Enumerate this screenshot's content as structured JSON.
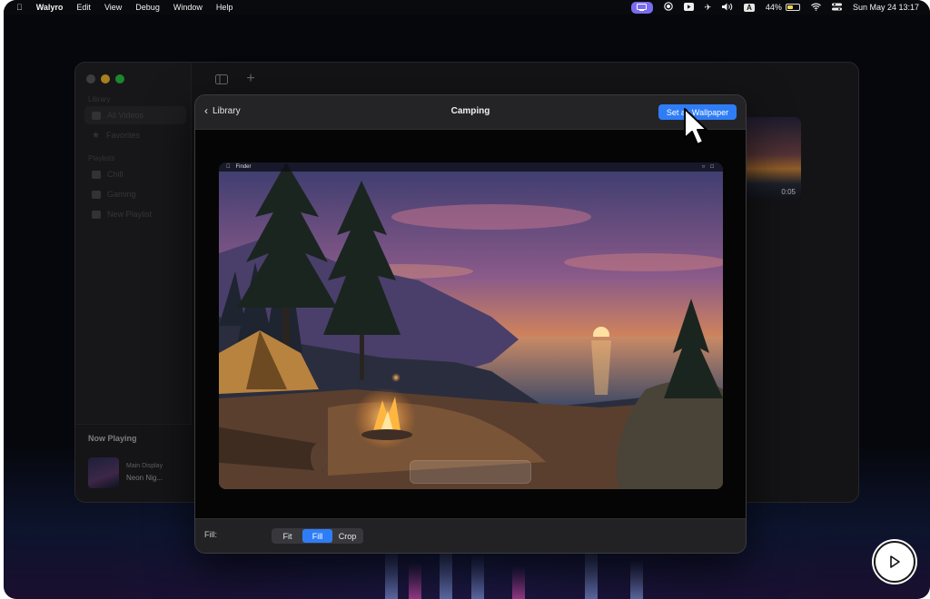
{
  "menubar": {
    "app_name": "Walyro",
    "menus": [
      "Edit",
      "View",
      "Debug",
      "Window",
      "Help"
    ],
    "input_source": "A",
    "battery": "44%",
    "datetime": "Sun May 24  13:17"
  },
  "sidebar": {
    "section_library": "Library",
    "item_all_videos": "All Videos",
    "item_favorites": "Favorites",
    "section_playlists": "Playlists",
    "item_chill": "Chill",
    "item_gaming": "Gaming",
    "item_new_playlist": "New Playlist"
  },
  "now_playing": {
    "title": "Now Playing",
    "display": "Main Display",
    "video_name": "Neon Nig..."
  },
  "grid": {
    "thumb_duration": "0:05"
  },
  "sheet": {
    "back_label": "Library",
    "title": "Camping",
    "set_wallpaper_label": "Set as Wallpaper",
    "preview_menubar_app": "Finder",
    "fill_label": "Fill:",
    "fill_options": [
      "Fit",
      "Fill",
      "Crop"
    ],
    "fill_selected": "Fill"
  },
  "colors": {
    "accent": "#2f7df6",
    "menu_pill": "#7a6cf0"
  }
}
